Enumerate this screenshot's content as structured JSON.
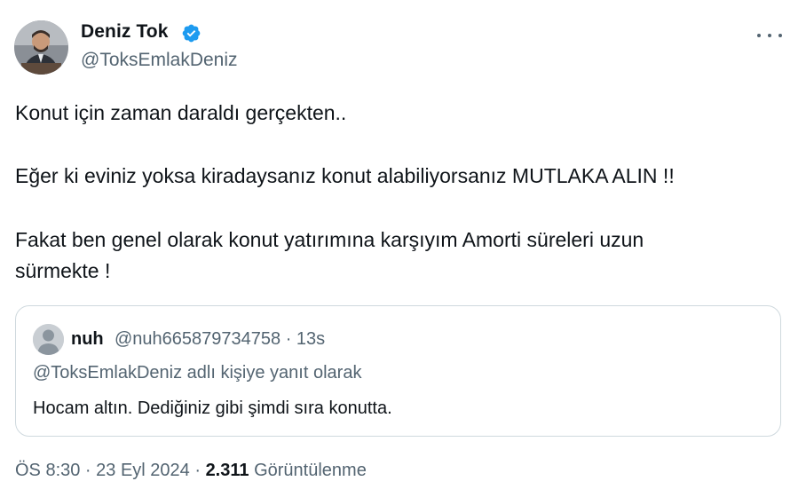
{
  "author": {
    "name": "Deniz Tok",
    "handle": "@ToksEmlakDeniz",
    "verified_color": "#1d9bf0"
  },
  "tweet": {
    "lines": [
      "Konut için zaman daraldı gerçekten..",
      "Eğer ki eviniz yoksa kiradaysanız konut alabiliyorsanız MUTLAKA ALIN !!",
      "Fakat ben genel olarak konut yatırımına karşıyım Amorti süreleri uzun",
      "sürmekte !"
    ]
  },
  "quote": {
    "name": "nuh",
    "handle_time": "@nuh665879734758 · 13s",
    "reply_context": "@ToksEmlakDeniz adlı kişiye yanıt olarak",
    "text": "Hocam altın. Dediğiniz gibi şimdi sıra konutta."
  },
  "meta": {
    "timestamp": "ÖS 8:30 · 23 Eyl 2024 · ",
    "views_count": "2.311",
    "views_label": " Görüntülenme"
  },
  "icons": {
    "verified": "verified-badge-icon",
    "more": "more-options-icon"
  }
}
